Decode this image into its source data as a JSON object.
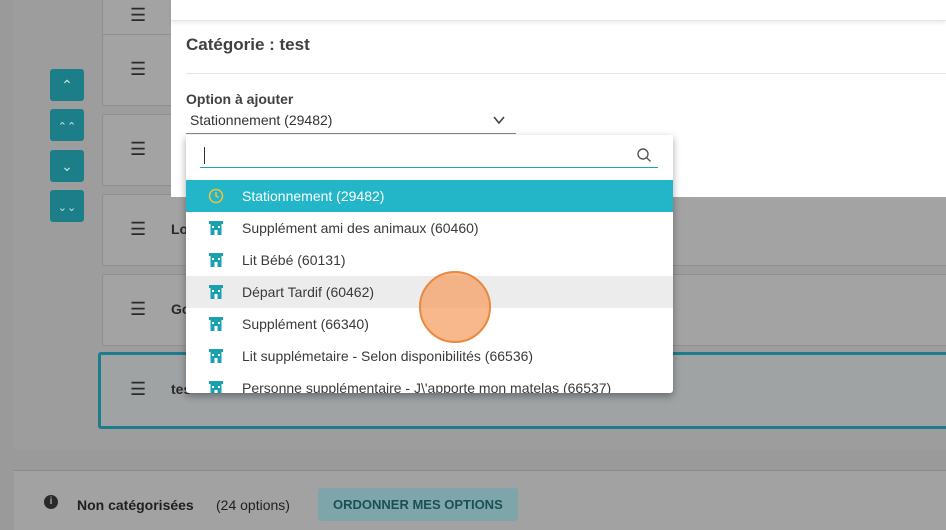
{
  "modal": {
    "category_title": "Catégorie : test",
    "option_label": "Option à ajouter",
    "selected_option": "Stationnement (29482)"
  },
  "dropdown": {
    "search_value": "",
    "items": [
      {
        "label": "Stationnement (29482)",
        "icon": "clock-icon",
        "state": "selected"
      },
      {
        "label": "Supplément ami des animaux (60460)",
        "icon": "hotel-icon",
        "state": ""
      },
      {
        "label": "Lit Bébé (60131)",
        "icon": "hotel-icon",
        "state": ""
      },
      {
        "label": "Départ Tardif (60462)",
        "icon": "hotel-icon",
        "state": "hover"
      },
      {
        "label": "Supplément (66340)",
        "icon": "hotel-icon",
        "state": ""
      },
      {
        "label": "Lit supplémetaire - Selon disponibilités (66536)",
        "icon": "hotel-icon",
        "state": ""
      },
      {
        "label": "Personne supplémentaire - J\\'apporte mon matelas (66537)",
        "icon": "hotel-icon",
        "state": ""
      }
    ]
  },
  "background": {
    "cards": [
      {
        "label": ""
      },
      {
        "label": ""
      },
      {
        "label": "Lo"
      },
      {
        "label": "Go"
      },
      {
        "label": "tes"
      }
    ],
    "bottom": {
      "title": "Non catégorisées",
      "count": "(24 options)",
      "order_button": "ORDONNER MES OPTIONS"
    }
  },
  "colors": {
    "accent": "#23b6c9",
    "selected_text": "#ffffff",
    "icon_teal": "#1a9fb0",
    "clock_yellow": "#f2c23a",
    "click_indicator": "#f5a064"
  }
}
